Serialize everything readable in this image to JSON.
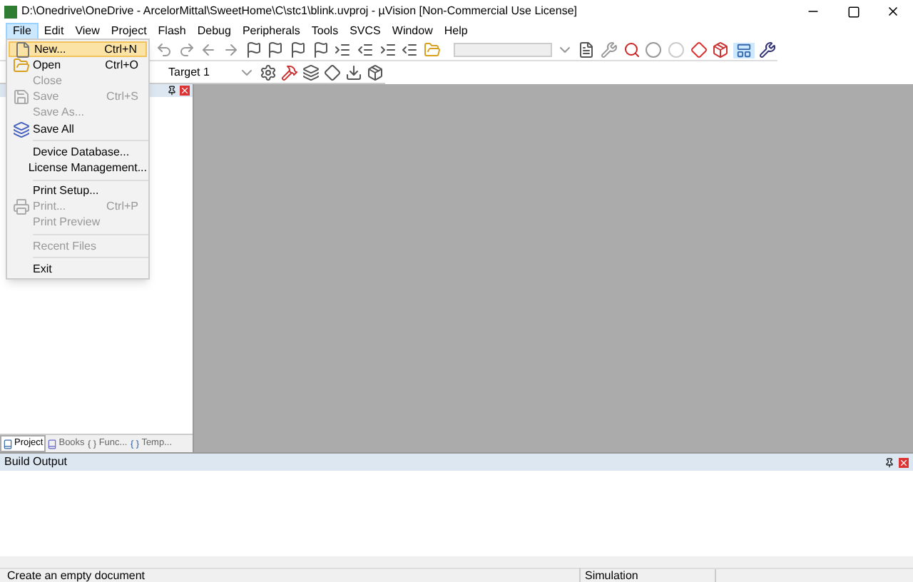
{
  "window": {
    "title": "D:\\Onedrive\\OneDrive - ArcelorMittal\\SweetHome\\C\\stc1\\blink.uvproj - µVision  [Non-Commercial Use License]"
  },
  "menu_bar": [
    {
      "label": "File",
      "selected": true
    },
    {
      "label": "Edit",
      "selected": false
    },
    {
      "label": "View",
      "selected": false
    },
    {
      "label": "Project",
      "selected": false
    },
    {
      "label": "Flash",
      "selected": false
    },
    {
      "label": "Debug",
      "selected": false
    },
    {
      "label": "Peripherals",
      "selected": false
    },
    {
      "label": "Tools",
      "selected": false
    },
    {
      "label": "SVCS",
      "selected": false
    },
    {
      "label": "Window",
      "selected": false
    },
    {
      "label": "Help",
      "selected": false
    }
  ],
  "file_menu": [
    {
      "kind": "item",
      "label": "New...",
      "shortcut": "Ctrl+N",
      "disabled": false,
      "selected": true
    },
    {
      "kind": "item",
      "label": "Open",
      "shortcut": "Ctrl+O",
      "disabled": false,
      "selected": false
    },
    {
      "kind": "item",
      "label": "Close",
      "disabled": true,
      "selected": false
    },
    {
      "kind": "item",
      "label": "Save",
      "shortcut": "Ctrl+S",
      "disabled": true,
      "selected": false
    },
    {
      "kind": "item",
      "label": "Save As...",
      "disabled": true,
      "selected": false
    },
    {
      "kind": "item",
      "label": "Save All",
      "disabled": false,
      "selected": false
    },
    {
      "kind": "separator"
    },
    {
      "kind": "item",
      "label": "Device Database...",
      "disabled": false,
      "selected": false
    },
    {
      "kind": "item",
      "label": "License Management...",
      "disabled": false,
      "selected": false
    },
    {
      "kind": "separator"
    },
    {
      "kind": "item",
      "label": "Print Setup...",
      "disabled": false,
      "selected": false
    },
    {
      "kind": "item",
      "label": "Print...",
      "shortcut": "Ctrl+P",
      "disabled": true,
      "selected": false
    },
    {
      "kind": "item",
      "label": "Print Preview",
      "disabled": true,
      "selected": false
    },
    {
      "kind": "separator"
    },
    {
      "kind": "item",
      "label": "Recent Files",
      "disabled": true,
      "selected": false
    },
    {
      "kind": "separator"
    },
    {
      "kind": "item",
      "label": "Exit",
      "disabled": false,
      "selected": false
    }
  ],
  "build_toolbar": {
    "target": "Target 1"
  },
  "project_panel": {
    "tabs": [
      {
        "label": "Project",
        "selected": true
      },
      {
        "label": "Books",
        "selected": false
      },
      {
        "label": "Func...",
        "selected": false
      },
      {
        "label": "Temp...",
        "selected": false
      }
    ]
  },
  "build_output": {
    "title": "Build Output"
  },
  "status_bar": {
    "message": "Create an empty document",
    "mode": "Simulation"
  }
}
